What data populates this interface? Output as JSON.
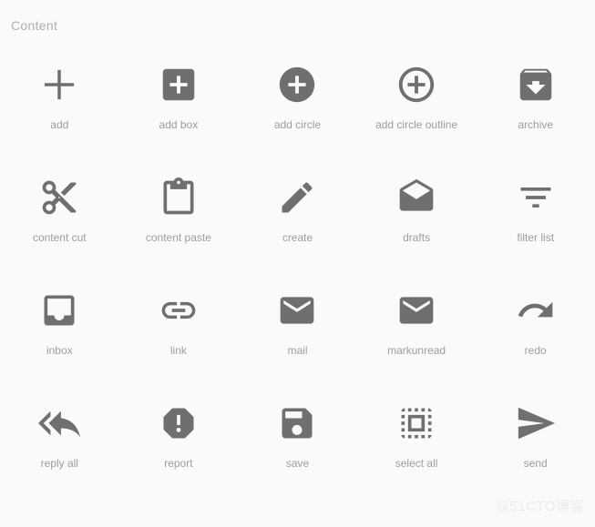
{
  "page": {
    "section_title": "Content",
    "watermark": "@51CTO博客",
    "background_color": "#fafafa",
    "icon_color": "#6f6f6f",
    "label_color": "#9d9d9d",
    "title_color": "#aeaeae",
    "columns": 5,
    "rows": 4
  },
  "icons": [
    {
      "label": "add",
      "name": "add-icon"
    },
    {
      "label": "add box",
      "name": "add-box-icon"
    },
    {
      "label": "add circle",
      "name": "add-circle-icon"
    },
    {
      "label": "add circle outline",
      "name": "add-circle-outline-icon"
    },
    {
      "label": "archive",
      "name": "archive-icon"
    },
    {
      "label": "content cut",
      "name": "content-cut-icon"
    },
    {
      "label": "content paste",
      "name": "content-paste-icon"
    },
    {
      "label": "create",
      "name": "create-icon"
    },
    {
      "label": "drafts",
      "name": "drafts-icon"
    },
    {
      "label": "filter list",
      "name": "filter-list-icon"
    },
    {
      "label": "inbox",
      "name": "inbox-icon"
    },
    {
      "label": "link",
      "name": "link-icon"
    },
    {
      "label": "mail",
      "name": "mail-icon"
    },
    {
      "label": "markunread",
      "name": "markunread-icon"
    },
    {
      "label": "redo",
      "name": "redo-icon"
    },
    {
      "label": "reply all",
      "name": "reply-all-icon"
    },
    {
      "label": "report",
      "name": "report-icon"
    },
    {
      "label": "save",
      "name": "save-icon"
    },
    {
      "label": "select all",
      "name": "select-all-icon"
    },
    {
      "label": "send",
      "name": "send-icon"
    }
  ]
}
